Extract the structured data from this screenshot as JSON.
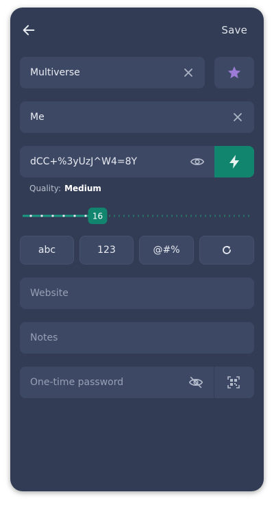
{
  "header": {
    "back_icon": "arrow-left-icon",
    "save_label": "Save"
  },
  "form": {
    "title_value": "Multiverse",
    "favorite_icon": "star-icon",
    "favorite_color": "#9b7bd6",
    "username_value": "Me",
    "password_value": "dCC+%3yUzJ^W4=8Y",
    "generate_icon": "lightning-icon",
    "accent_color": "#12856f",
    "quality_label": "Quality:",
    "quality_value": "Medium",
    "length_value": "16",
    "length_fraction": 0.32,
    "options": [
      {
        "label": "abc"
      },
      {
        "label": "123"
      },
      {
        "label": "@#%"
      },
      {
        "label": "refresh-icon"
      }
    ],
    "website_placeholder": "Website",
    "notes_placeholder": "Notes",
    "otp_placeholder": "One-time password",
    "otp_icon_hidden": "eye-off-icon",
    "qr_icon": "qr-scan-icon"
  }
}
